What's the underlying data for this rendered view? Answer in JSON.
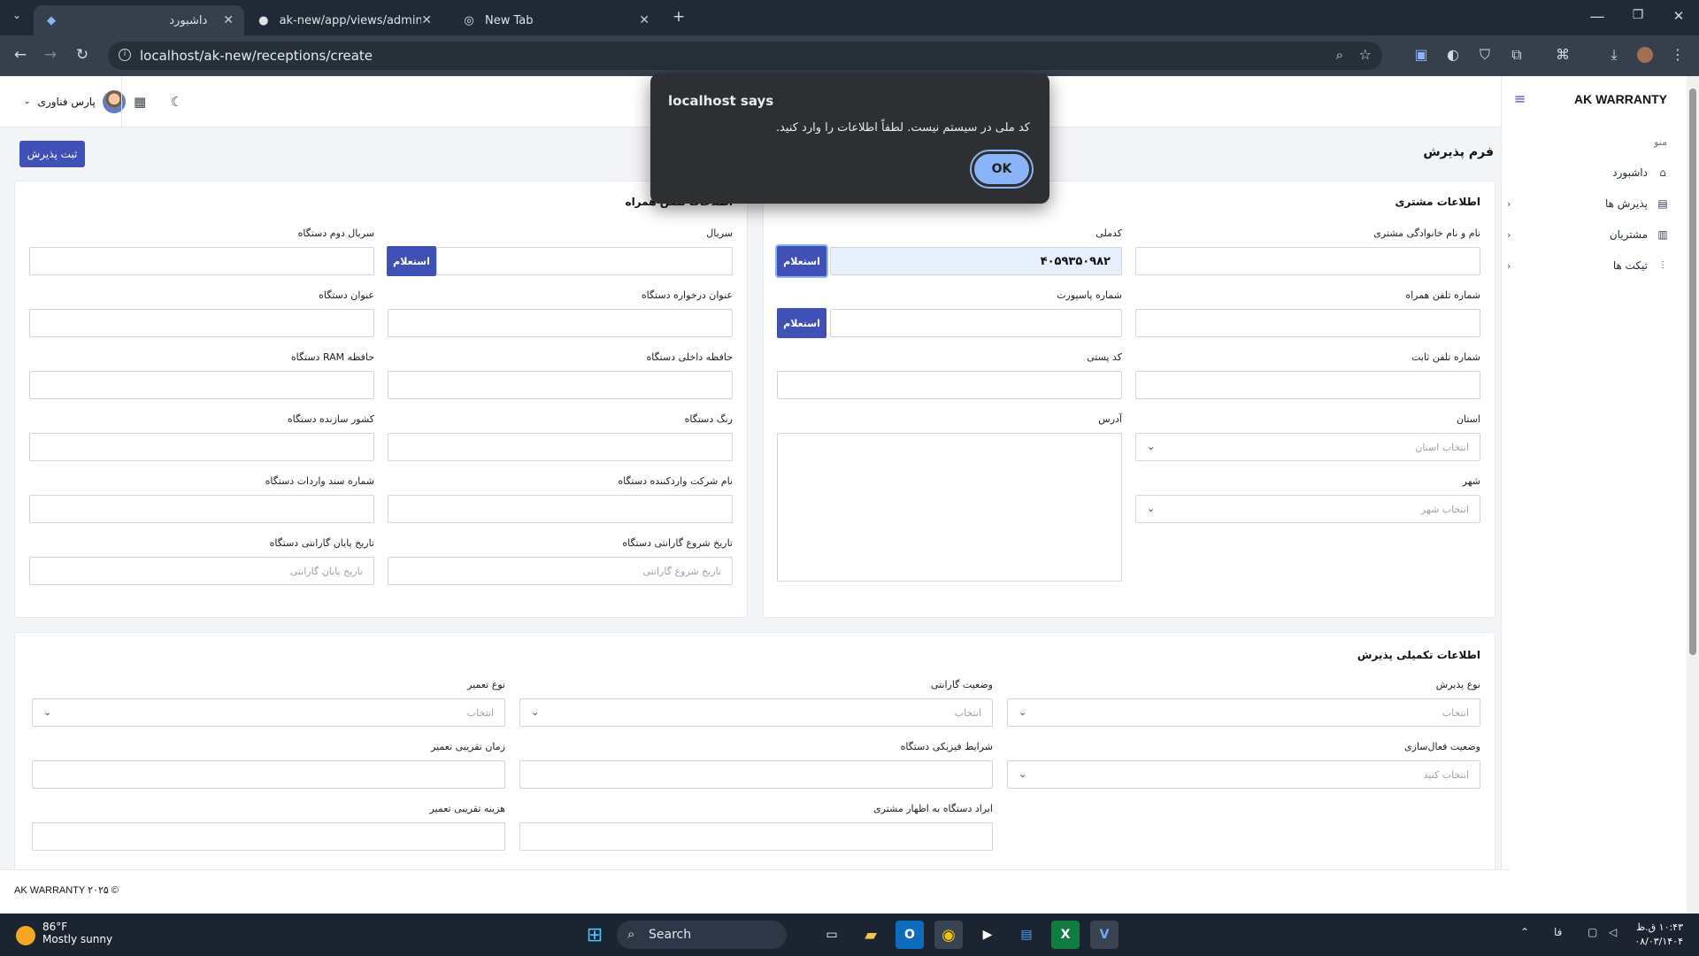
{
  "browser": {
    "tabs": [
      {
        "title": "داشبورد",
        "active": true
      },
      {
        "title": "ak-new/app/views/admin/recep",
        "active": false
      },
      {
        "title": "New Tab",
        "active": false
      }
    ],
    "url": "localhost/ak-new/receptions/create"
  },
  "app": {
    "brand": "AK WARRANTY",
    "menu_caption": "منو",
    "sidebar": [
      {
        "label": "داشبورد",
        "icon": "home-icon",
        "chevron": false
      },
      {
        "label": "پذیرش ها",
        "icon": "receipt-icon",
        "chevron": true
      },
      {
        "label": "مشتریان",
        "icon": "users-icon",
        "chevron": true
      },
      {
        "label": "تیکت ها",
        "icon": "sliders-icon",
        "chevron": true
      }
    ],
    "user_name": "پارس فناوری",
    "page_title": "فرم پذیرش",
    "submit_label": "ثبت پذیرش",
    "inquiry_label": "استعلام",
    "footer": "AK WARRANTY ۲۰۲۵ ©"
  },
  "customer_card": {
    "title": "اطلاعات مشتری",
    "fields": {
      "full_name": {
        "label": "نام و نام خانوادگی مشتری",
        "value": ""
      },
      "national_code": {
        "label": "کدملی",
        "value": "۴۰۵۹۳۵۰۹۸۲"
      },
      "mobile": {
        "label": "شماره تلفن همراه",
        "value": ""
      },
      "passport": {
        "label": "شماره پاسپورت",
        "value": ""
      },
      "landline": {
        "label": "شماره تلفن ثابت",
        "value": ""
      },
      "postal_code": {
        "label": "کد پستی",
        "value": ""
      },
      "province": {
        "label": "استان",
        "placeholder": "انتخاب استان"
      },
      "address": {
        "label": "آدرس"
      },
      "city": {
        "label": "شهر",
        "placeholder": "انتخاب شهر"
      }
    }
  },
  "device_card": {
    "title": "اطلاعات تلفن همراه",
    "fields": {
      "serial": {
        "label": "سریال"
      },
      "serial2": {
        "label": "سریال دوم دستگاه"
      },
      "request_title": {
        "label": "عنوان درخواره دستگاه"
      },
      "device_title": {
        "label": "عنوان دستگاه"
      },
      "storage": {
        "label": "حافظه داخلی دستگاه"
      },
      "ram": {
        "label": "حافظه RAM دستگاه"
      },
      "color": {
        "label": "رنگ دستگاه"
      },
      "country": {
        "label": "کشور سازنده دستگاه"
      },
      "importer": {
        "label": "نام شرکت واردکننده دستگاه"
      },
      "import_doc": {
        "label": "شماره سند واردات دستگاه"
      },
      "warranty_start": {
        "label": "تاریخ شروع گارانتی دستگاه",
        "placeholder": "تاریخ شروع گارانتی"
      },
      "warranty_end": {
        "label": "تاریخ پایان گارانتی دستگاه",
        "placeholder": "تاریخ پایان گارانتی"
      }
    }
  },
  "extra_card": {
    "title": "اطلاعات تکمیلی پذیرش",
    "fields": {
      "reception_type": {
        "label": "نوع پذیرش",
        "placeholder": "انتخاب"
      },
      "warranty_status": {
        "label": "وضعیت گارانتی",
        "placeholder": "انتخاب"
      },
      "repair_type": {
        "label": "نوع تعمیر",
        "placeholder": "انتخاب"
      },
      "activation": {
        "label": "وضعیت فعال‌سازی",
        "placeholder": "انتخاب کنید"
      },
      "physical": {
        "label": "شرایط فیزیکی دستگاه"
      },
      "repair_time": {
        "label": "زمان تقریبی تعمیر"
      },
      "complaint": {
        "label": "ایراد دستگاه به اظهار مشتری"
      },
      "repair_cost": {
        "label": "هزینه تقریبی تعمیر"
      }
    }
  },
  "dialog": {
    "title": "localhost says",
    "message": "کد ملی در سیستم نیست. لطفاً اطلاعات را وارد کنید.",
    "ok": "OK"
  },
  "taskbar": {
    "temp": "86°F",
    "weather": "Mostly sunny",
    "search": "Search",
    "lang": "فا",
    "time": "۱۰:۴۳ ق.ظ",
    "date": "۰۸/۰۳/۱۴۰۴"
  }
}
